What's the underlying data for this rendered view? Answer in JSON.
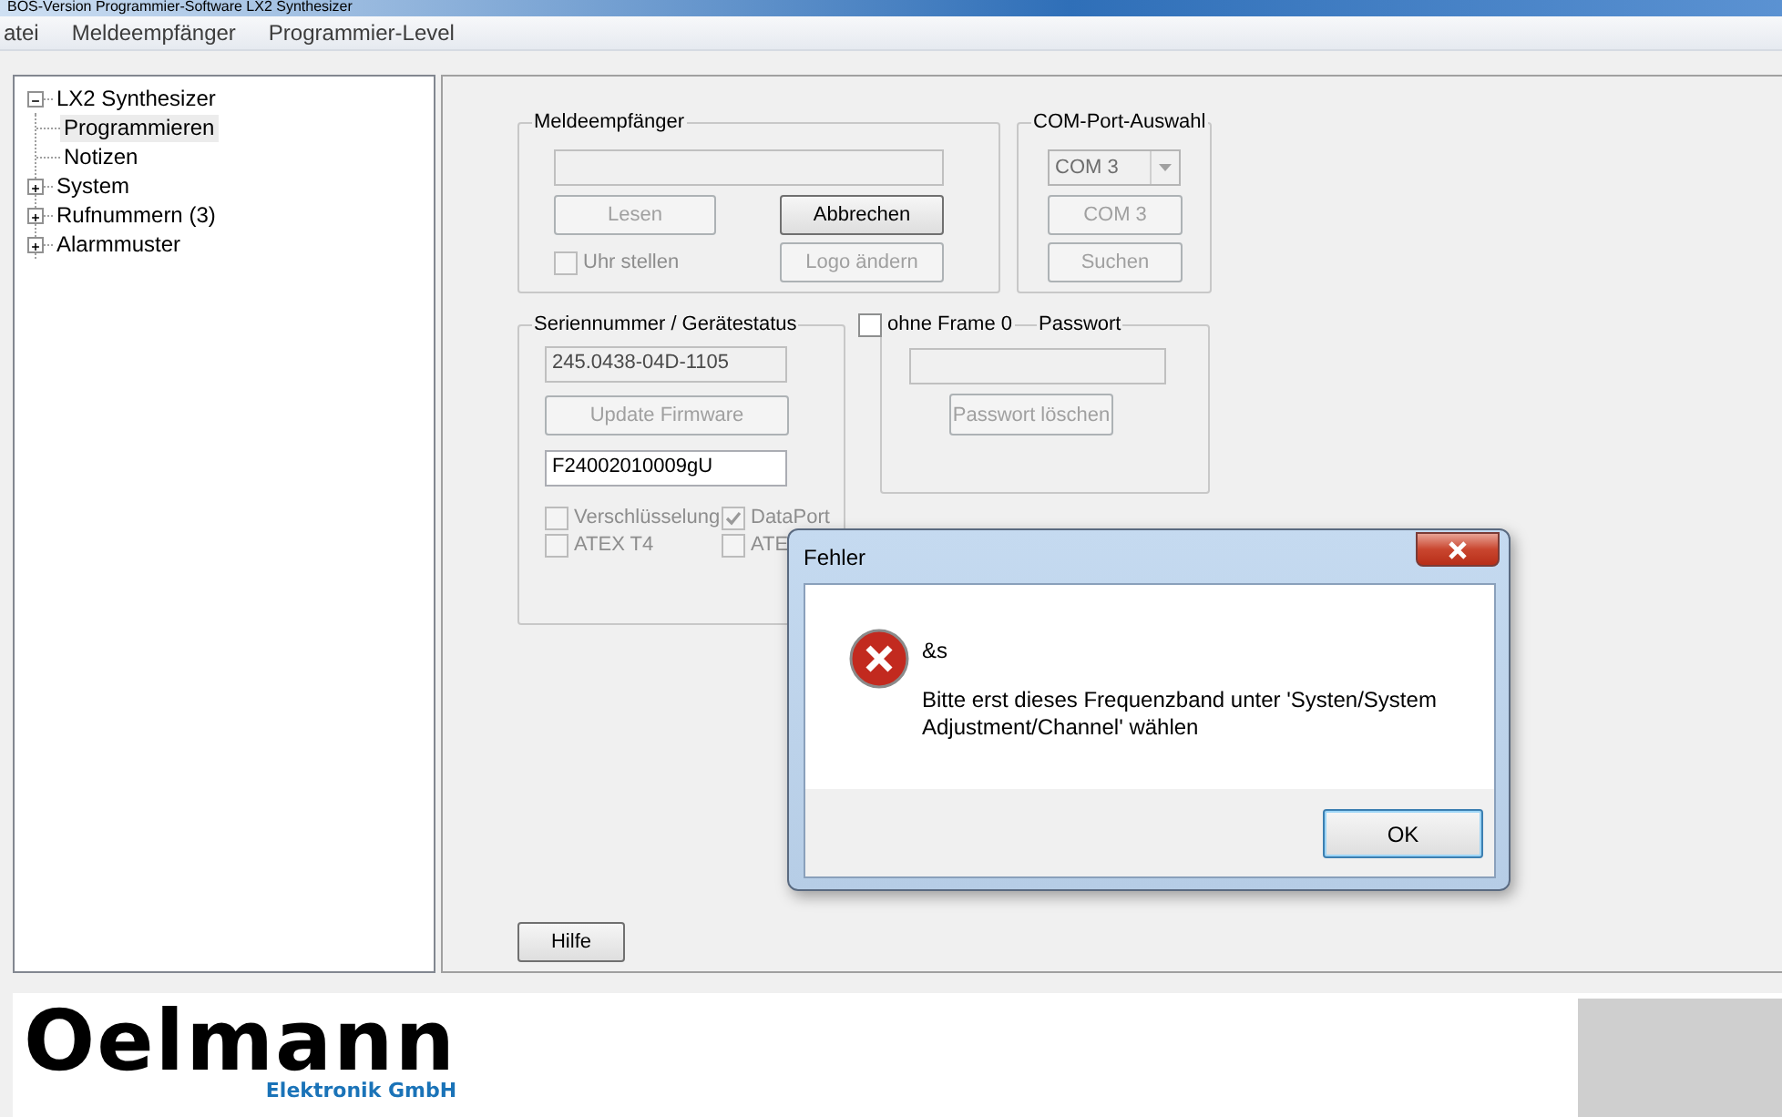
{
  "window": {
    "title": "BOS-Version Programmier-Software LX2 Synthesizer"
  },
  "menu": [
    {
      "label": "atei"
    },
    {
      "label": "Meldeempfänger"
    },
    {
      "label": "Programmier-Level"
    }
  ],
  "tree": [
    {
      "label": "LX2 Synthesizer",
      "kind": "folder",
      "expanded": true,
      "selected": false,
      "children": [
        {
          "label": "Programmieren",
          "kind": "leaf",
          "selected": true
        },
        {
          "label": "Notizen",
          "kind": "leaf",
          "selected": false
        },
        {
          "label": "System",
          "kind": "folder",
          "expanded": false,
          "selected": false
        },
        {
          "label": "Rufnummern (3)",
          "kind": "folder",
          "expanded": false,
          "selected": false
        },
        {
          "label": "Alarmmuster",
          "kind": "folder",
          "expanded": false,
          "selected": false
        }
      ]
    }
  ],
  "groups": [
    {
      "title": "Meldeempfänger",
      "controls": [
        {
          "kind": "field",
          "disabled": true
        },
        {
          "kind": "button",
          "label": "Lesen",
          "disabled": true
        },
        {
          "kind": "button",
          "label": "Abbrechen",
          "disabled": false
        },
        {
          "kind": "checkbox",
          "label": "Uhr stellen",
          "checked": false,
          "disabled": true
        },
        {
          "kind": "button",
          "label": "Logo ändern",
          "disabled": true
        }
      ]
    },
    {
      "title": "COM-Port-Auswahl",
      "controls": [
        {
          "kind": "combo",
          "value": "COM 3",
          "disabled": true
        },
        {
          "kind": "button",
          "label": "COM 3",
          "disabled": true
        },
        {
          "kind": "button",
          "label": "Suchen",
          "disabled": true
        }
      ]
    },
    {
      "title": "Seriennummer / Gerätestatus",
      "controls": [
        {
          "kind": "field",
          "value": "245.0438-04D-1105",
          "disabled": true
        },
        {
          "kind": "button",
          "label": "Update Firmware",
          "disabled": true
        },
        {
          "kind": "field",
          "value": "F24002010009gU",
          "disabled": false
        },
        {
          "kind": "checkbox",
          "label": "Verschlüsselung",
          "checked": false,
          "disabled": true
        },
        {
          "kind": "checkbox",
          "label": "DataPort",
          "checked": true,
          "disabled": true
        },
        {
          "kind": "checkbox",
          "label": "ATEX T4",
          "checked": false,
          "disabled": true
        },
        {
          "kind": "checkbox",
          "label": "ATE",
          "checked": false,
          "disabled": true
        }
      ]
    },
    {
      "title": "Passwort",
      "title_checkbox": {
        "label": "ohne Frame 0",
        "checked": false,
        "disabled": false
      },
      "controls": [
        {
          "kind": "field",
          "disabled": true
        },
        {
          "kind": "button",
          "label": "Passwort löschen",
          "disabled": true
        }
      ]
    }
  ],
  "help_button": {
    "label": "Hilfe",
    "disabled": false
  },
  "dialog": {
    "title": "Fehler",
    "heading": "&s",
    "message": "Bitte erst dieses Frequenzband unter 'Systen/System Adjustment/Channel' wählen",
    "buttons": [
      {
        "label": "OK",
        "focused": true
      }
    ]
  },
  "footer": {
    "logo_text": "Oelmann",
    "logo_subtitle": "Elektronik GmbH"
  }
}
